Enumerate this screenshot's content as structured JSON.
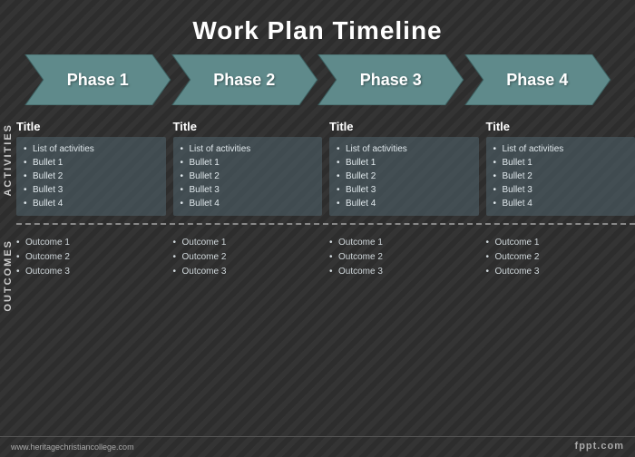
{
  "title": "Work Plan Timeline",
  "phases": [
    {
      "id": "phase-1",
      "label": "Phase 1"
    },
    {
      "id": "phase-2",
      "label": "Phase 2"
    },
    {
      "id": "phase-3",
      "label": "Phase 3"
    },
    {
      "id": "phase-4",
      "label": "Phase 4"
    }
  ],
  "sections": {
    "activities_label": "Activities",
    "outcomes_label": "Outcomes"
  },
  "columns": [
    {
      "title": "Title",
      "activities": [
        "List of activities",
        "Bullet 1",
        "Bullet 2",
        "Bullet 3",
        "Bullet 4"
      ],
      "outcomes": [
        "Outcome 1",
        "Outcome 2",
        "Outcome 3"
      ]
    },
    {
      "title": "Title",
      "activities": [
        "List of activities",
        "Bullet 1",
        "Bullet 2",
        "Bullet 3",
        "Bullet 4"
      ],
      "outcomes": [
        "Outcome 1",
        "Outcome 2",
        "Outcome 3"
      ]
    },
    {
      "title": "Title",
      "activities": [
        "List of activities",
        "Bullet 1",
        "Bullet 2",
        "Bullet 3",
        "Bullet 4"
      ],
      "outcomes": [
        "Outcome 1",
        "Outcome 2",
        "Outcome 3"
      ]
    },
    {
      "title": "Title",
      "activities": [
        "List of activities",
        "Bullet 1",
        "Bullet 2",
        "Bullet 3",
        "Bullet 4"
      ],
      "outcomes": [
        "Outcome 1",
        "Outcome 2",
        "Outcome 3"
      ]
    }
  ],
  "footer": {
    "url": "www.heritagechristiancollege.com",
    "brand": "fppt.com"
  },
  "colors": {
    "phase_fill": "#5f8a8b",
    "phase_dark": "#3d6162",
    "background": "#2d2d2d"
  }
}
